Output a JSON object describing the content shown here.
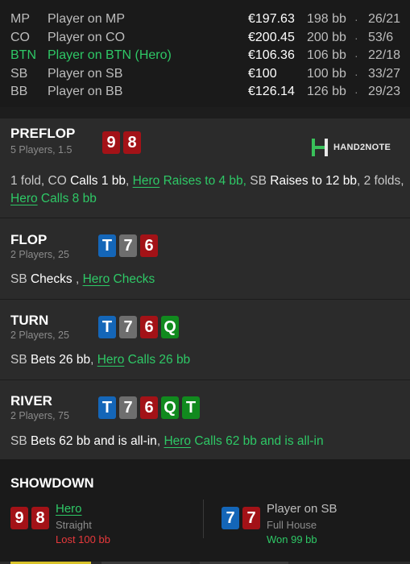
{
  "players": [
    {
      "pos": "MP",
      "name": "Player on MP",
      "stack": "€197.63",
      "bb": "198 bb",
      "dot": "·",
      "stats": "26/21",
      "hero": false
    },
    {
      "pos": "CO",
      "name": "Player on CO",
      "stack": "€200.45",
      "bb": "200 bb",
      "dot": "·",
      "stats": "53/6",
      "hero": false
    },
    {
      "pos": "BTN",
      "name": "Player on BTN (Hero)",
      "stack": "€106.36",
      "bb": "106 bb",
      "dot": "·",
      "stats": "22/18",
      "hero": true
    },
    {
      "pos": "SB",
      "name": "Player on SB",
      "stack": "€100",
      "bb": "100 bb",
      "dot": "·",
      "stats": "33/27",
      "hero": false
    },
    {
      "pos": "BB",
      "name": "Player on BB",
      "stack": "€126.14",
      "bb": "126 bb",
      "dot": "·",
      "stats": "29/23",
      "hero": false
    }
  ],
  "logo": {
    "text": "HAND2NOTE",
    "icon": "hand2note-logo-icon"
  },
  "preflop": {
    "title": "PREFLOP",
    "sub": "5 Players, 1.5",
    "cards": [
      "9",
      "8"
    ],
    "action": {
      "p1": "1 fold, CO ",
      "w1": "Calls 1 bb",
      "p2": ", ",
      "hero1": "Hero",
      "g1": " Raises to 4 bb,",
      "p3": " SB ",
      "w2": "Raises to 12 bb",
      "p4": ", 2 folds, ",
      "hero2": "Hero",
      "g2": " Calls 8 bb"
    }
  },
  "flop": {
    "title": "FLOP",
    "sub": "2 Players, 25",
    "cards": [
      "T",
      "7",
      "6"
    ],
    "action": {
      "p1": "SB ",
      "w1": "Checks",
      "p2": " , ",
      "hero": "Hero",
      "g1": " Checks"
    }
  },
  "turn": {
    "title": "TURN",
    "sub": "2 Players, 25",
    "cards": [
      "T",
      "7",
      "6",
      "Q"
    ],
    "action": {
      "p1": "SB ",
      "w1": "Bets 26 bb",
      "p2": ", ",
      "hero": "Hero",
      "g1": " Calls 26 bb"
    }
  },
  "river": {
    "title": "RIVER",
    "sub": "2 Players, 75",
    "cards": [
      "T",
      "7",
      "6",
      "Q",
      "T"
    ],
    "action": {
      "p1": "SB ",
      "w1": "Bets 62 bb and is all-in",
      "p2": ", ",
      "hero": "Hero",
      "g1": " Calls 62 bb and is all-in"
    }
  },
  "showdown": {
    "title": "SHOWDOWN",
    "hero": {
      "cards": [
        "9",
        "8"
      ],
      "name": "Hero",
      "hand": "Straight",
      "result": "Lost 100 bb"
    },
    "villain": {
      "cards": [
        "7",
        "7"
      ],
      "name": "Player on SB",
      "hand": "Full House",
      "result": "Won 99 bb"
    }
  },
  "colors": {
    "hero_green": "#2ec866",
    "loss_red": "#e8393c",
    "card_red": "#a31217",
    "card_blue": "#1466b8",
    "card_grey": "#6e6e6e",
    "card_green": "#118a1e"
  }
}
